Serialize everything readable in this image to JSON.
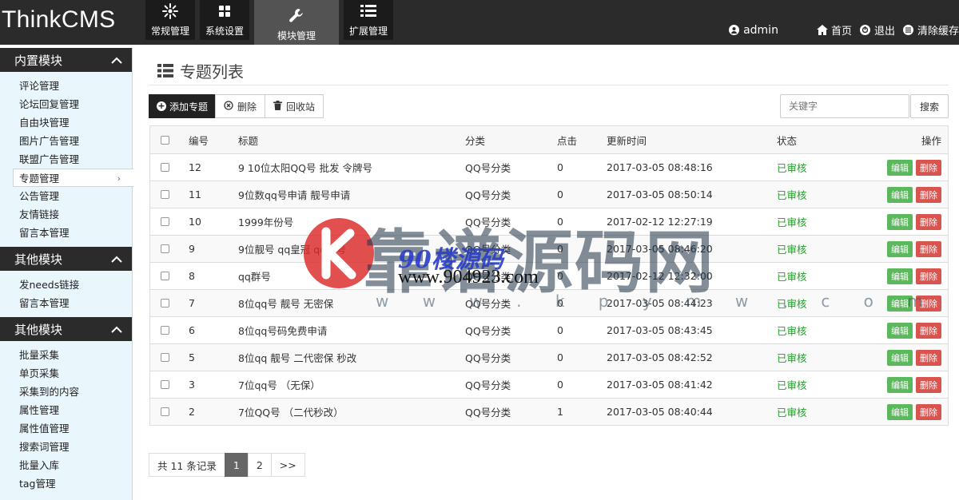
{
  "app": {
    "logo": "ThinkCMS"
  },
  "topnav": [
    {
      "label": "常规管理",
      "icon": "sun-icon"
    },
    {
      "label": "系统设置",
      "icon": "grid-icon"
    },
    {
      "label": "模块管理",
      "icon": "wrench-icon",
      "active": true
    },
    {
      "label": "扩展管理",
      "icon": "list-icon"
    }
  ],
  "topright": {
    "user": "admin",
    "home": "首页",
    "logout": "退出",
    "clear_cache": "清除缓存"
  },
  "sidebar": {
    "groups": [
      {
        "title": "内置模块",
        "items": [
          "评论管理",
          "论坛回复管理",
          "自由块管理",
          "图片广告管理",
          "联盟广告管理",
          "专题管理",
          "公告管理",
          "友情链接",
          "留言本管理"
        ]
      },
      {
        "title": "其他模块",
        "items": [
          "发needs链接",
          "留言本管理"
        ]
      },
      {
        "title": "其他模块",
        "items": [
          "批量采集",
          "单页采集",
          "采集到的内容",
          "属性管理",
          "属性值管理",
          "搜索词管理",
          "批量入库",
          "tag管理"
        ]
      }
    ]
  },
  "main": {
    "title": "专题列表",
    "toolbar": {
      "add": "添加专题",
      "delete": "删除",
      "recycle": "回收站"
    },
    "search": {
      "placeholder": "关键字",
      "button": "搜索"
    },
    "table": {
      "headers": {
        "id": "编号",
        "title": "标题",
        "category": "分类",
        "hits": "点击",
        "updated": "更新时间",
        "status": "状态",
        "ops": "操作"
      },
      "rows": [
        {
          "id": "12",
          "title": "9 10位太阳QQ号 批发 令牌号",
          "category": "QQ号分类",
          "hits": "0",
          "updated": "2017-03-05 08:48:16",
          "status": "已审核"
        },
        {
          "id": "11",
          "title": "9位数qq号申请 靓号申请",
          "category": "QQ号分类",
          "hits": "0",
          "updated": "2017-03-05 08:50:14",
          "status": "已审核"
        },
        {
          "id": "10",
          "title": "1999年份号",
          "category": "QQ号分类",
          "hits": "0",
          "updated": "2017-02-12 12:27:19",
          "status": "已审核"
        },
        {
          "id": "9",
          "title": "9位靓号 qq皇冠 qq靓号",
          "category": "QQ号分类",
          "hits": "0",
          "updated": "2017-03-05 08:46:20",
          "status": "已审核"
        },
        {
          "id": "8",
          "title": "qq群号",
          "category": "QQ号分类",
          "hits": "0",
          "updated": "2017-02-12 12:32:00",
          "status": "已审核"
        },
        {
          "id": "7",
          "title": "8位qq号 靓号 无密保",
          "category": "QQ号分类",
          "hits": "0",
          "updated": "2017-03-05 08:44:23",
          "status": "已审核"
        },
        {
          "id": "6",
          "title": "8位qq号码免费申请",
          "category": "QQ号分类",
          "hits": "0",
          "updated": "2017-03-05 08:43:45",
          "status": "已审核"
        },
        {
          "id": "5",
          "title": "8位qq 靓号 二代密保 秒改",
          "category": "QQ号分类",
          "hits": "0",
          "updated": "2017-03-05 08:42:52",
          "status": "已审核"
        },
        {
          "id": "3",
          "title": "7位qq号 （无保）",
          "category": "QQ号分类",
          "hits": "0",
          "updated": "2017-03-05 08:41:42",
          "status": "已审核"
        },
        {
          "id": "2",
          "title": "7位QQ号 （二代秒改）",
          "category": "QQ号分类",
          "hits": "1",
          "updated": "2017-03-05 08:40:44",
          "status": "已审核"
        }
      ],
      "edit_label": "编辑",
      "delete_label": "删除"
    },
    "pager": {
      "total": "共 11 条记录",
      "pages": [
        "1",
        "2"
      ],
      "next": ">>"
    }
  },
  "watermark": {
    "big": "靠谱源码网",
    "overlay": "90楼源码",
    "url": "www.904923.com",
    "sub": "w w w . k p y m w . c o m"
  },
  "colors": {
    "topbar": "#2b2b2b",
    "sidebar_bg": "#e9f6fb",
    "edit": "#5cb85c",
    "delete": "#d9534f",
    "status_ok": "#22a02a"
  }
}
